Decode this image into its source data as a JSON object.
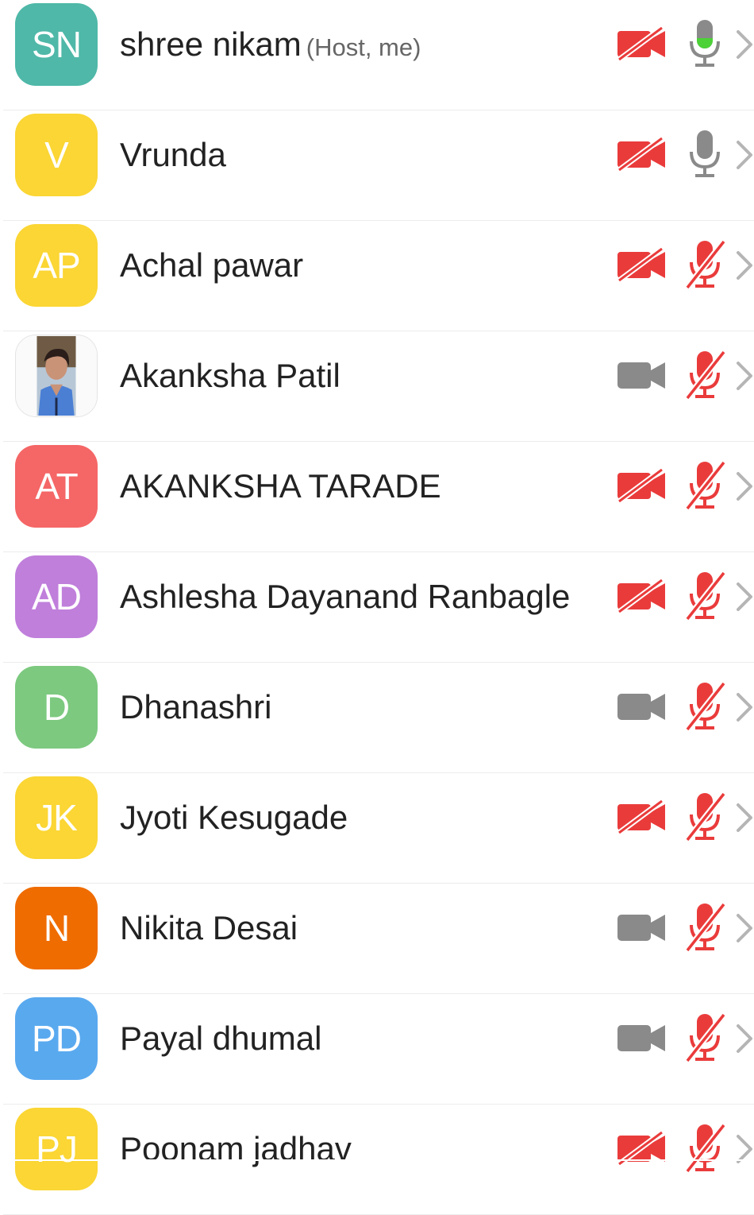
{
  "participants": [
    {
      "initials": "SN",
      "name": "shree nikam",
      "tag": "(Host, me)",
      "avatar_color": "#4fb8a8",
      "video": "off",
      "audio": "on-speaking"
    },
    {
      "initials": "V",
      "name": "Vrunda",
      "tag": "",
      "avatar_color": "#fbd634",
      "video": "off",
      "audio": "on"
    },
    {
      "initials": "AP",
      "name": "Achal pawar",
      "tag": "",
      "avatar_color": "#fbd634",
      "video": "off",
      "audio": "muted"
    },
    {
      "initials": "",
      "name": "Akanksha Patil",
      "tag": "",
      "avatar_color": "photo",
      "video": "on",
      "audio": "muted"
    },
    {
      "initials": "AT",
      "name": "AKANKSHA TARADE",
      "tag": "",
      "avatar_color": "#f56666",
      "video": "off",
      "audio": "muted"
    },
    {
      "initials": "AD",
      "name": "Ashlesha Dayanand Ranbagle",
      "tag": "",
      "avatar_color": "#c07fdb",
      "video": "off",
      "audio": "muted"
    },
    {
      "initials": "D",
      "name": "Dhanashri",
      "tag": "",
      "avatar_color": "#7cc97f",
      "video": "on",
      "audio": "muted"
    },
    {
      "initials": "JK",
      "name": "Jyoti Kesugade",
      "tag": "",
      "avatar_color": "#fbd634",
      "video": "off",
      "audio": "muted"
    },
    {
      "initials": "N",
      "name": "Nikita Desai",
      "tag": "",
      "avatar_color": "#ef6c00",
      "video": "on",
      "audio": "muted"
    },
    {
      "initials": "PD",
      "name": "Payal dhumal",
      "tag": "",
      "avatar_color": "#59a9ef",
      "video": "on",
      "audio": "muted"
    },
    {
      "initials": "PJ",
      "name": "Poonam jadhav",
      "tag": "",
      "avatar_color": "#fbd634",
      "video": "off",
      "audio": "muted"
    }
  ],
  "colors": {
    "muted_red": "#ea3b3b",
    "icon_gray": "#8a8a8a",
    "speaking_green": "#4cd137",
    "chevron": "#b5b5b5"
  },
  "icons": {
    "video_off": "video-off-icon",
    "video_on": "video-camera-icon",
    "mic_on": "microphone-icon",
    "mic_muted": "microphone-muted-icon",
    "chevron": "chevron-right-icon"
  }
}
